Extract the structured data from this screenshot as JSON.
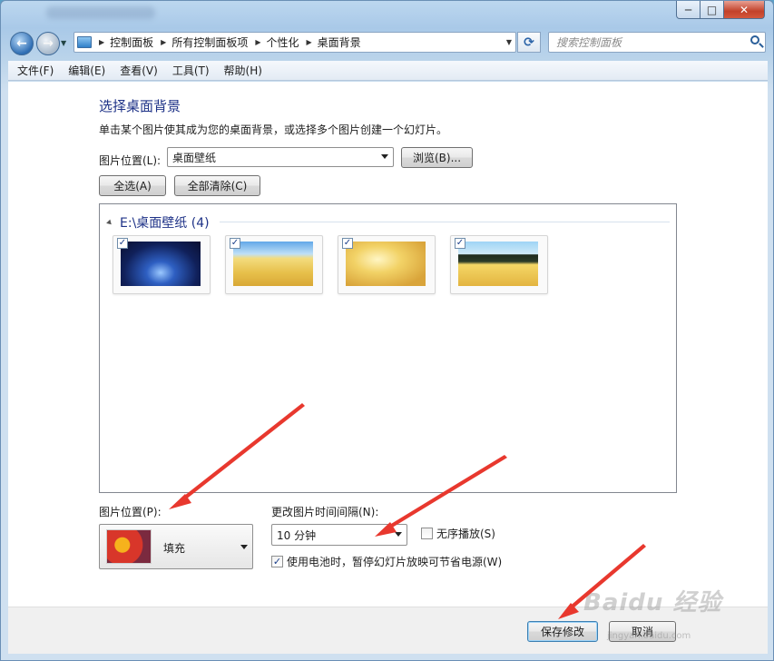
{
  "colors": {
    "accent_heading": "#1e3287",
    "annotation_arrow": "#e8382e"
  },
  "window": {
    "minimize": "─",
    "maximize": "□",
    "close": "✕"
  },
  "nav": {
    "back_icon": "←",
    "forward_icon": "→",
    "history_icon": "▼",
    "refresh_icon": "⟳"
  },
  "address": {
    "breadcrumbs": [
      "控制面板",
      "所有控制面板项",
      "个性化",
      "桌面背景"
    ],
    "separator": "▶",
    "dropdown_icon": "▼"
  },
  "search": {
    "placeholder": "搜索控制面板"
  },
  "menu": [
    "文件(F)",
    "编辑(E)",
    "查看(V)",
    "工具(T)",
    "帮助(H)"
  ],
  "page": {
    "heading": "选择桌面背景",
    "description": "单击某个图片使其成为您的桌面背景，或选择多个图片创建一个幻灯片。",
    "picture_location_label": "图片位置(L):",
    "picture_location_value": "桌面壁纸",
    "browse_button": "浏览(B)...",
    "select_all_button": "全选(A)",
    "clear_all_button": "全部清除(C)"
  },
  "gallery": {
    "group_title": "E:\\桌面壁纸 (4)",
    "items": [
      {
        "checked": true,
        "checkmark": "✓"
      },
      {
        "checked": true,
        "checkmark": "✓"
      },
      {
        "checked": true,
        "checkmark": "✓"
      },
      {
        "checked": true,
        "checkmark": "✓"
      }
    ]
  },
  "settings": {
    "position_label": "图片位置(P):",
    "position_value": "填充",
    "interval_label": "更改图片时间间隔(N):",
    "interval_value": "10 分钟",
    "shuffle_label": "无序播放(S)",
    "shuffle_checked": false,
    "battery_label": "使用电池时，暂停幻灯片放映可节省电源(W)",
    "battery_checked": true,
    "checkmark": "✓"
  },
  "footer": {
    "save_button": "保存修改",
    "cancel_button": "取消"
  },
  "watermark": {
    "text": "Baidu 经验",
    "sub": "jingyan.baidu.com"
  }
}
